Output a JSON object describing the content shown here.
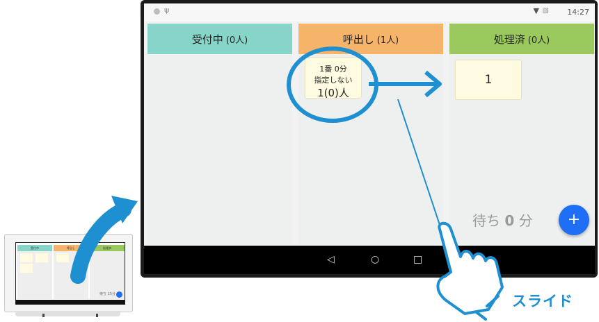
{
  "status_bar": {
    "time": "14:27",
    "left_icons": [
      "circle-icon",
      "usb-icon"
    ],
    "right_icons": [
      "wifi-icon",
      "no-sim-icon"
    ]
  },
  "columns": [
    {
      "title": "受付中",
      "count": "(0人)",
      "color": "#87d5c8"
    },
    {
      "title": "呼出し",
      "count": "(1人)",
      "color": "#f5b46a"
    },
    {
      "title": "処理済",
      "count": "(0人)",
      "color": "#9ac95e"
    }
  ],
  "calling_card": {
    "line1": "1番 0分",
    "line2": "指定しない",
    "line3": "1(0)人"
  },
  "done_card": {
    "number": "1"
  },
  "wait": {
    "prefix": "待ち",
    "value": "0",
    "unit": "分"
  },
  "fab": {
    "label": "+",
    "color": "#1e6ff5"
  },
  "nav": {
    "back": "◁",
    "home": "○",
    "recent": "□"
  },
  "slide_label": "スライド",
  "mini_tablet": {
    "headers": [
      "受付中",
      "呼出し",
      "処理済"
    ],
    "wait_text": "待ち 15分"
  },
  "accent_color": "#1e8fd0"
}
